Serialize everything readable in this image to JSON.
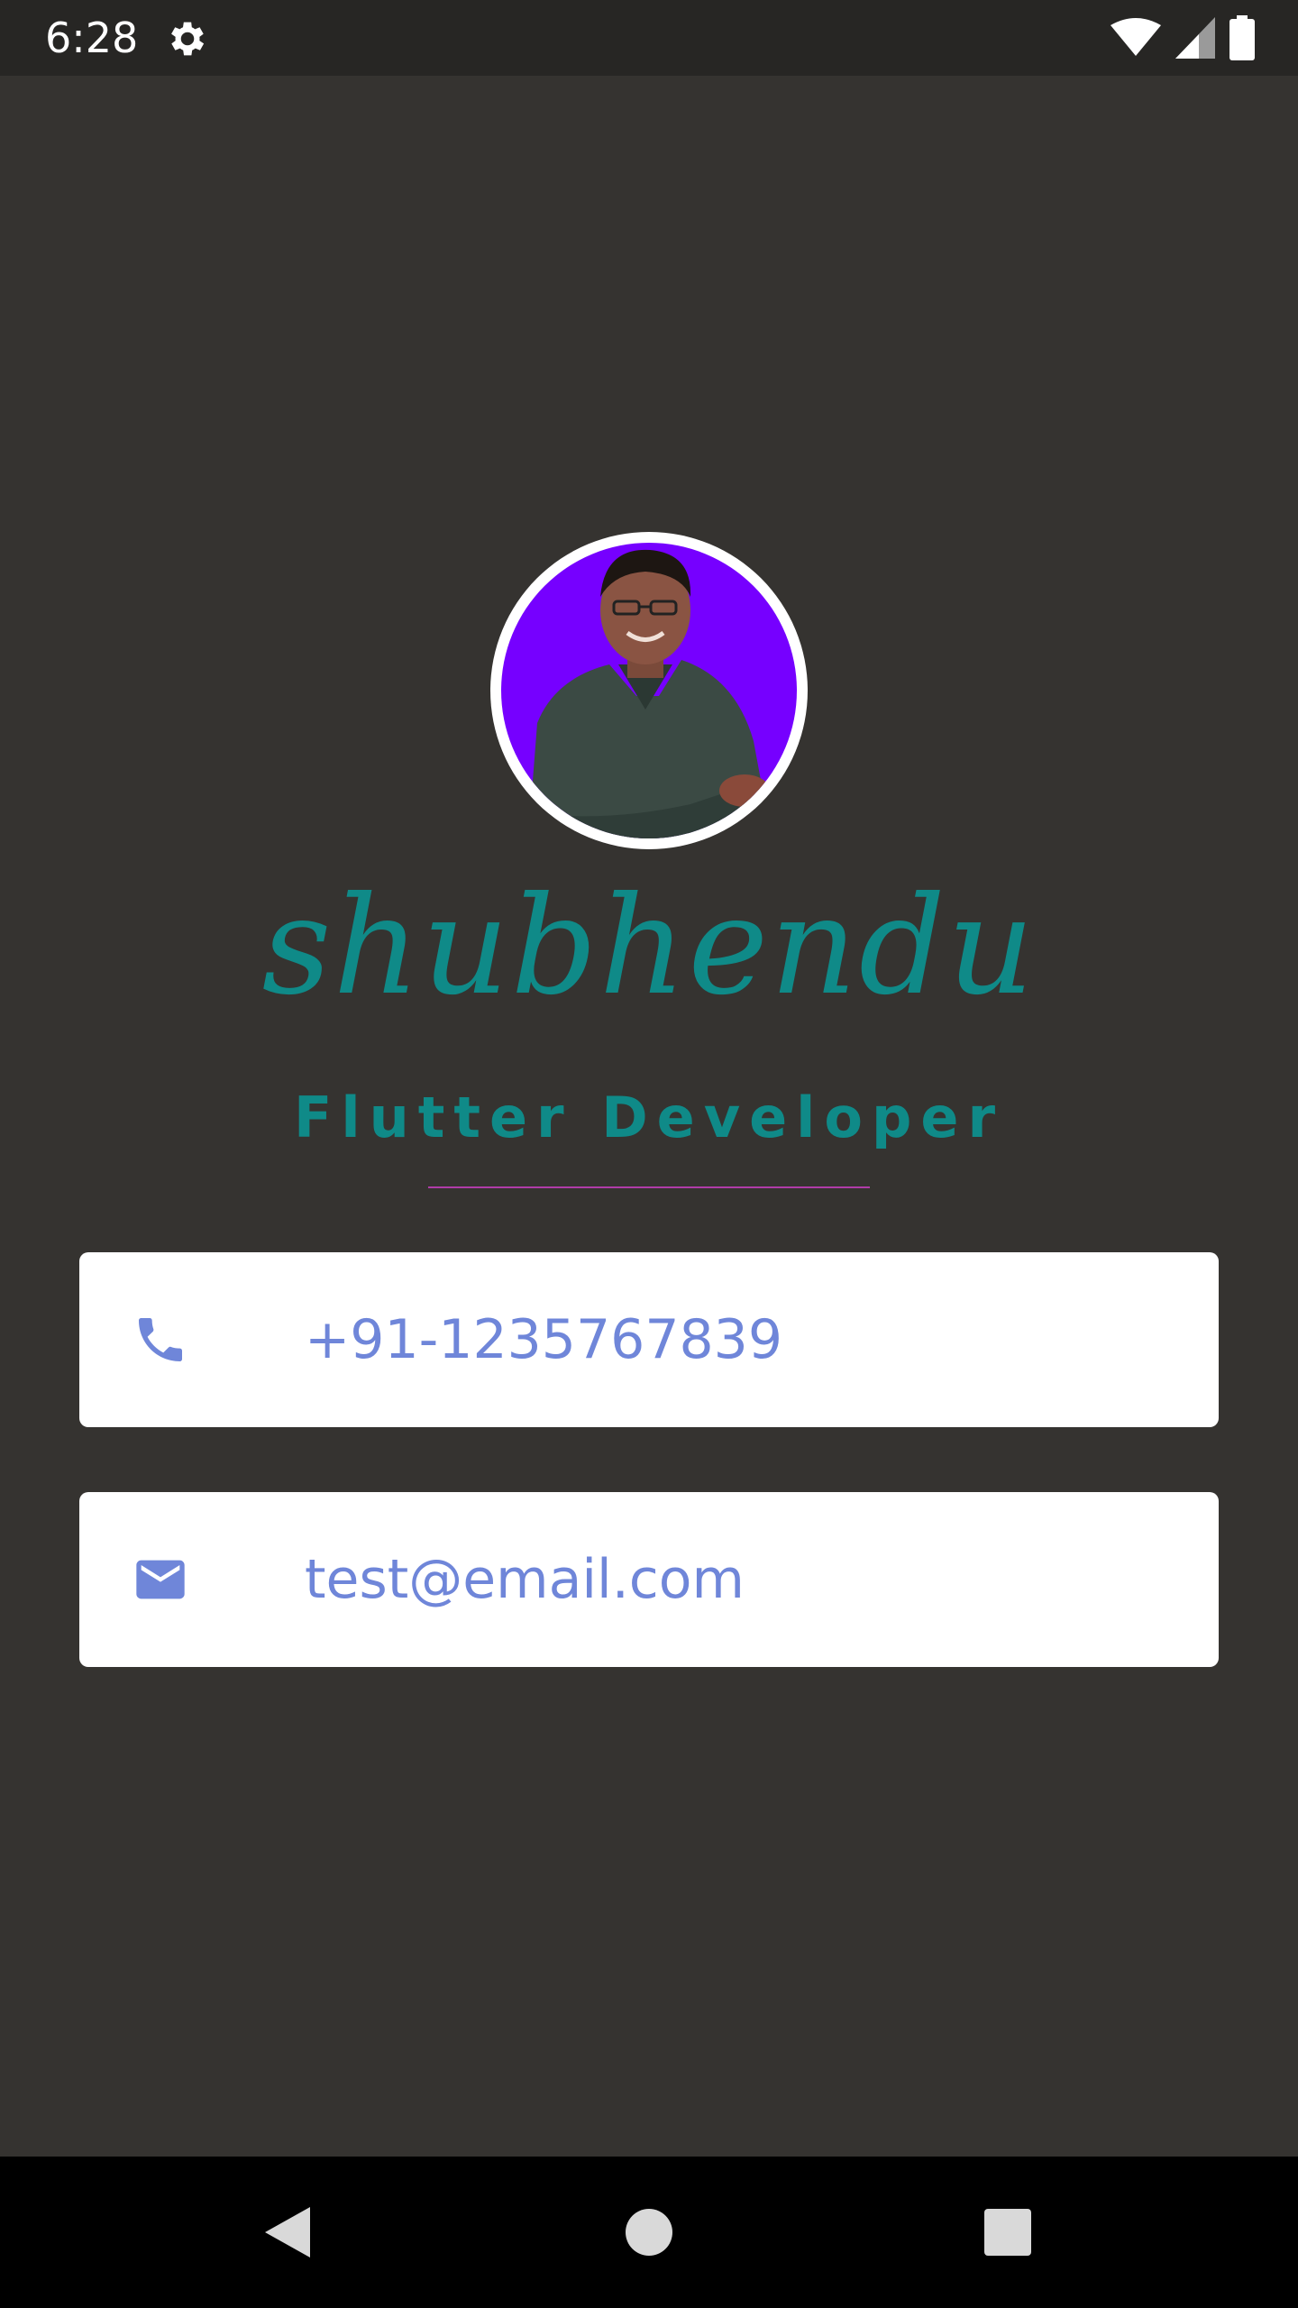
{
  "status_bar": {
    "time": "6:28",
    "icons": [
      "settings-icon",
      "wifi-icon",
      "cellular-signal-icon",
      "battery-icon"
    ]
  },
  "profile": {
    "name": "shubhendu",
    "title": "Flutter Developer",
    "avatar_background": "#7600ff"
  },
  "contacts": {
    "phone": {
      "icon": "phone-icon",
      "value": "+91-1235767839"
    },
    "email": {
      "icon": "email-icon",
      "value": "test@email.com"
    }
  },
  "nav_bar": {
    "buttons": [
      "back-icon",
      "home-icon",
      "recents-icon"
    ]
  },
  "colors": {
    "background": "#353330",
    "accent_teal": "#0f8a88",
    "contact_text": "#6f86d9",
    "divider": "#b03ca8",
    "card": "#ffffff"
  }
}
